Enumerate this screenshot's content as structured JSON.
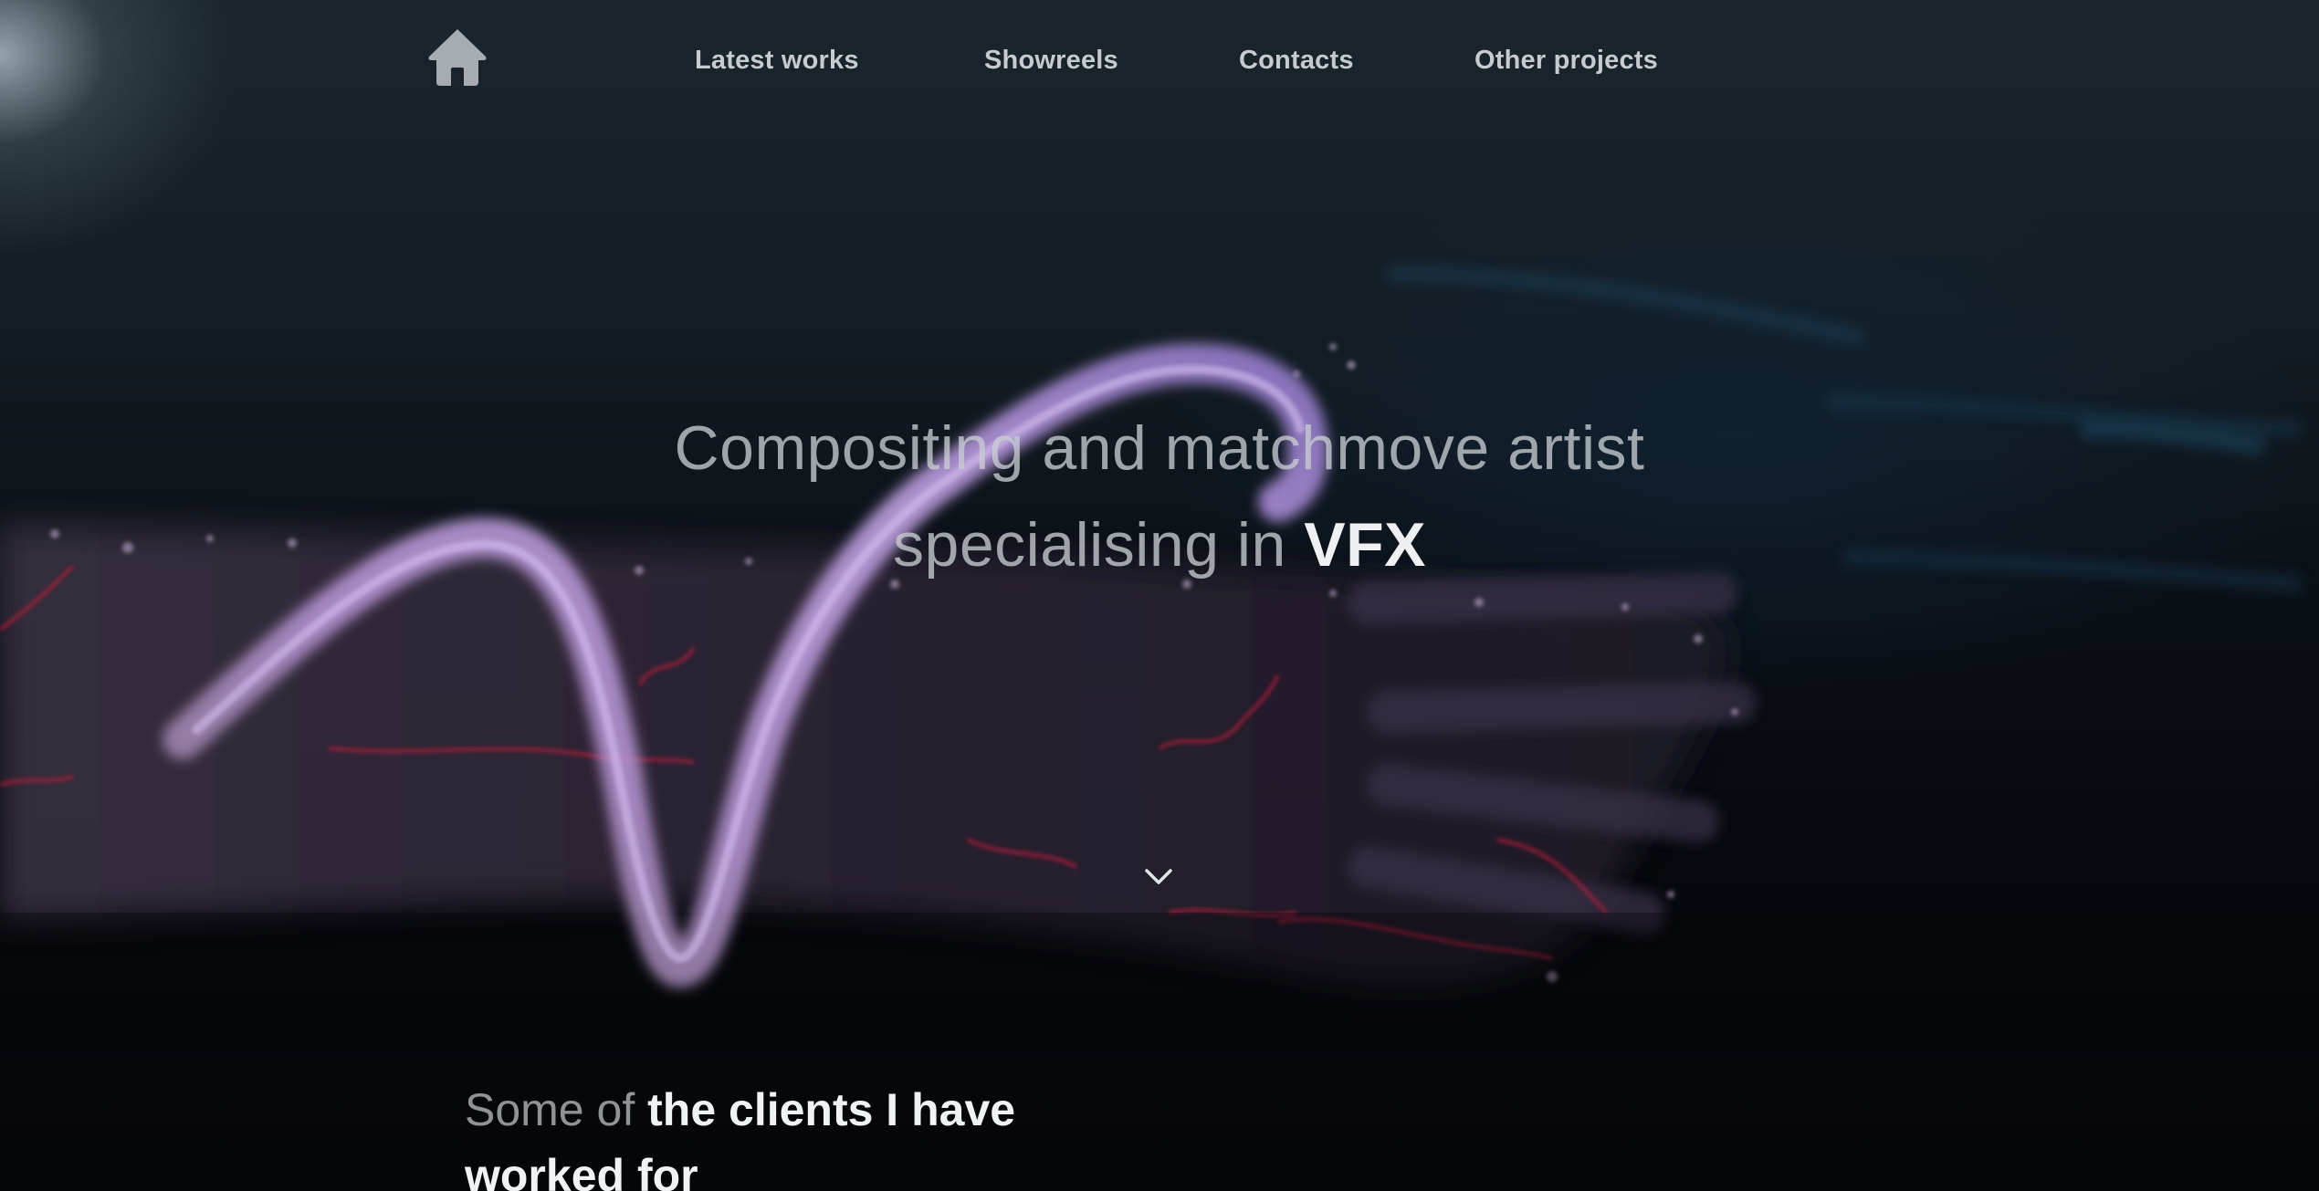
{
  "nav": {
    "home_icon": "home-icon",
    "links": [
      {
        "label": "Latest works"
      },
      {
        "label": "Showreels"
      },
      {
        "label": "Contacts"
      },
      {
        "label": "Other projects"
      }
    ]
  },
  "hero": {
    "headline_line1": "Compositing and matchmove artist",
    "headline_line2_light": "specialising in",
    "headline_line2_strong": "VFX",
    "scroll_icon": "chevron-down-icon"
  },
  "clients": {
    "heading_light": "Some of",
    "heading_strong": "the clients I have worked for"
  },
  "colors": {
    "background": "#05070b",
    "nav_text": "#c6cbd0",
    "accent_purple": "#b48ee6",
    "particle_red": "#c0203e"
  }
}
